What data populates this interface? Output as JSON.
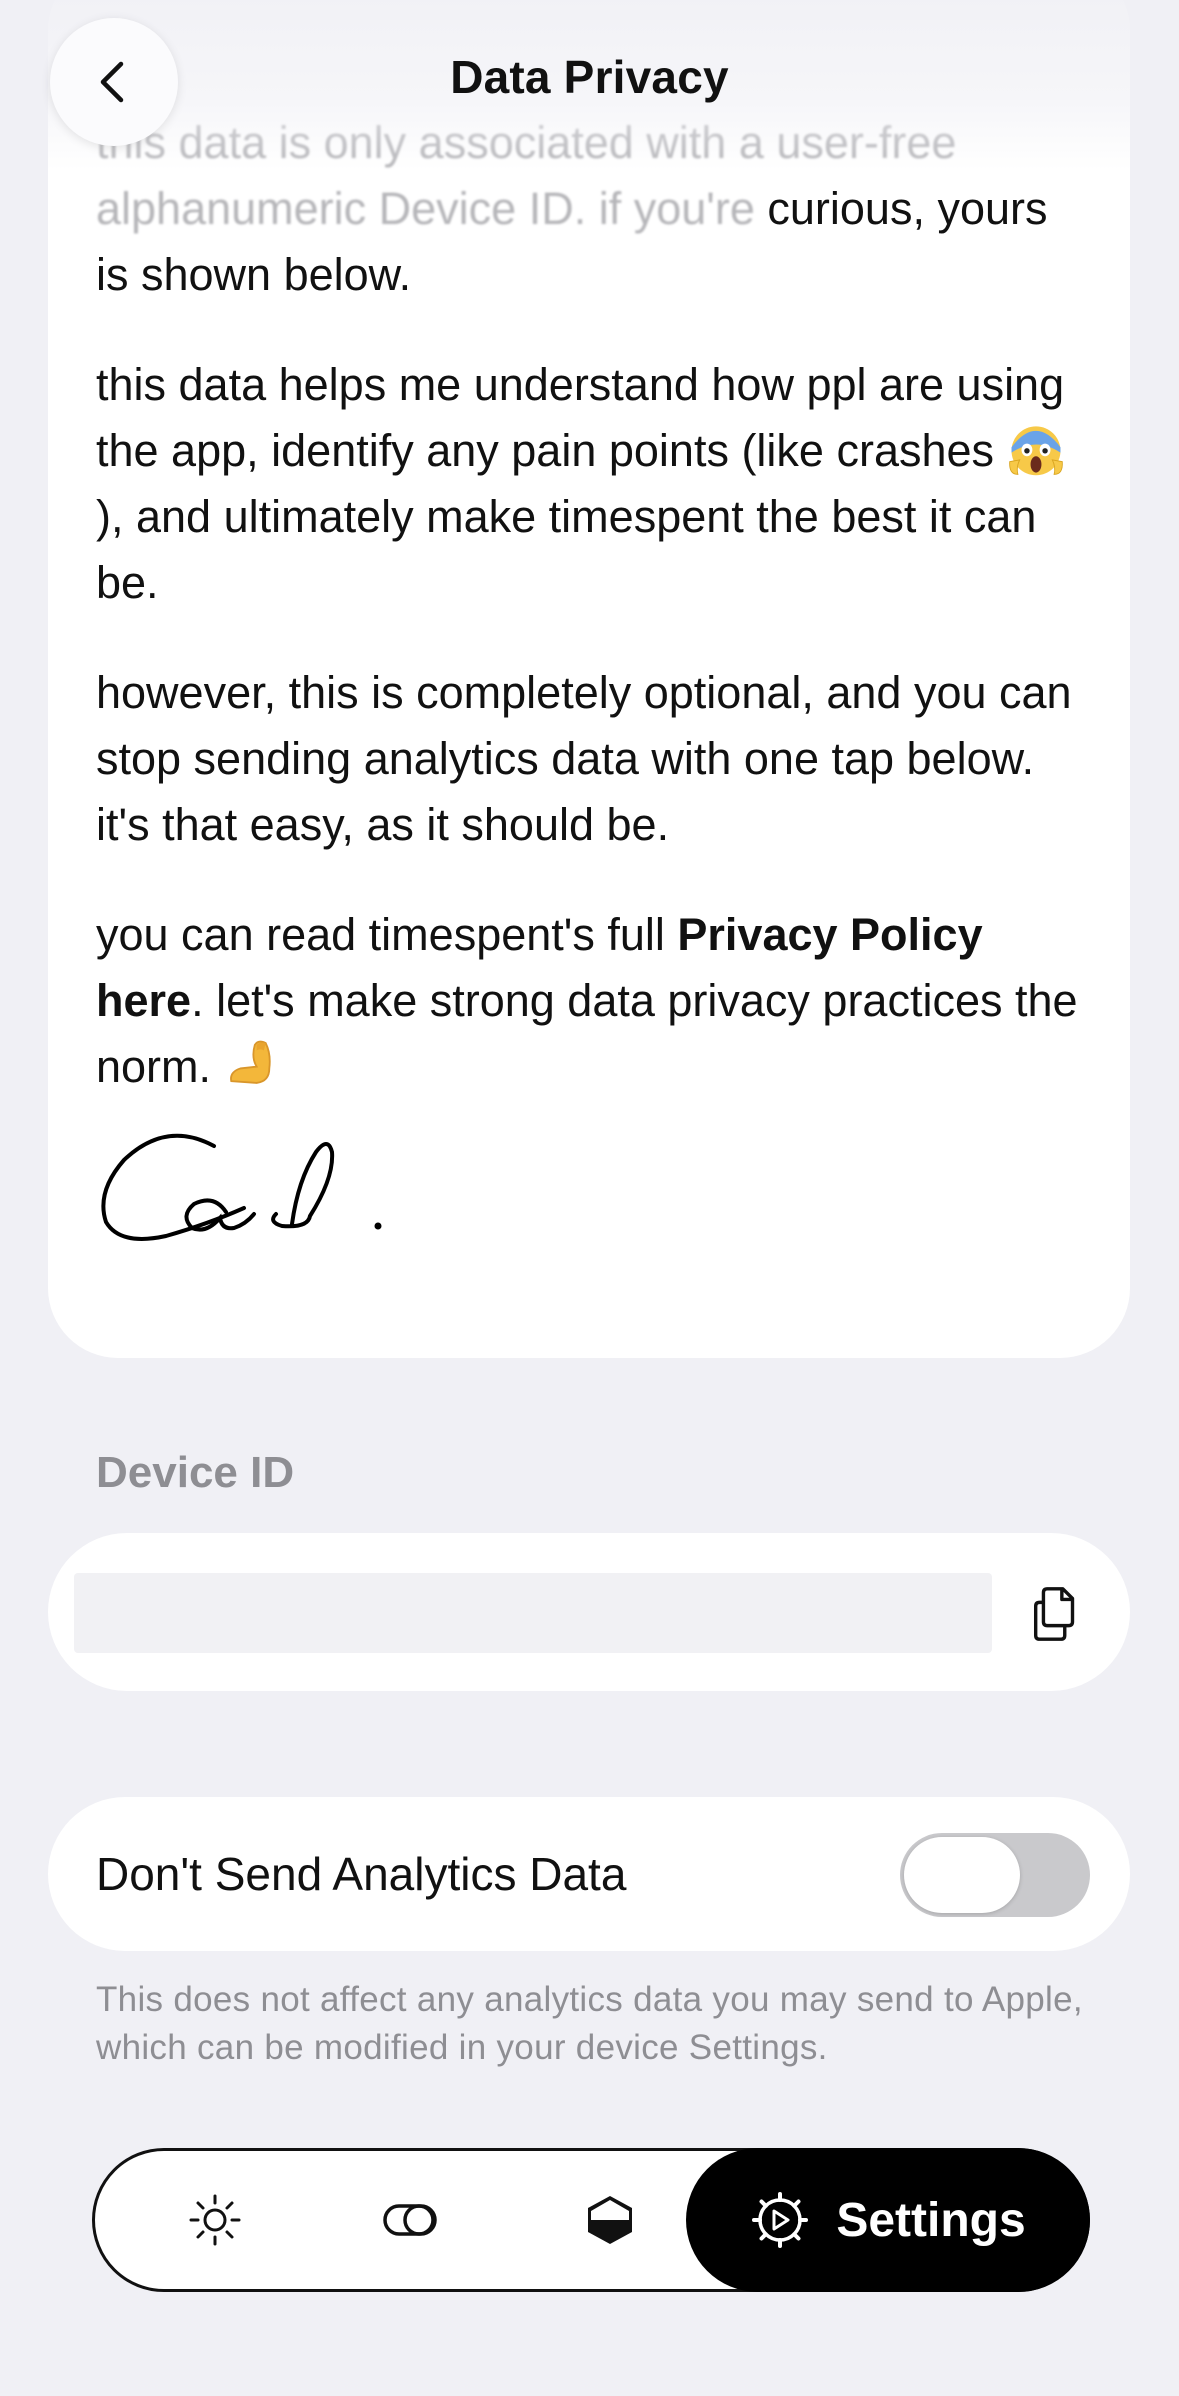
{
  "header": {
    "title": "Data Privacy",
    "back_icon": "chevron-left-icon"
  },
  "content": {
    "faded_intro": "this data is only associated with a user-free alphanumeric Device ID. if you're",
    "intro_tail": "curious, yours is shown below.",
    "paragraph_2_before": "this data helps me understand how ppl are using the app, identify any pain points (like crashes ",
    "paragraph_2_after": "), and ultimately make timespent the best it can be.",
    "paragraph_3": "however, this is completely optional, and you can stop sending analytics data with one tap below. it's that easy, as it should be.",
    "paragraph_4_before": "you can read timespent's full ",
    "privacy_link": "Privacy Policy here",
    "paragraph_4_after": ". let's make strong data privacy practices the norm. ",
    "signature": "Cal."
  },
  "device": {
    "section_label": "Device ID",
    "device_id_value": "",
    "copy_icon": "copy-icon"
  },
  "analytics": {
    "toggle_label": "Don't Send Analytics Data",
    "toggle_state": false,
    "footnote": "This does not affect any analytics data you may send to Apple, which can be modified in your device Settings."
  },
  "tabbar": {
    "tabs": [
      {
        "icon": "sun-icon"
      },
      {
        "icon": "toggle-icon"
      },
      {
        "icon": "shield-icon"
      },
      {
        "icon": "gear-icon",
        "label": "Settings",
        "active": true
      }
    ]
  },
  "colors": {
    "background": "#f0f0f5",
    "card": "#ffffff",
    "secondary_text": "#8e8e93",
    "active_tab": "#000000"
  }
}
